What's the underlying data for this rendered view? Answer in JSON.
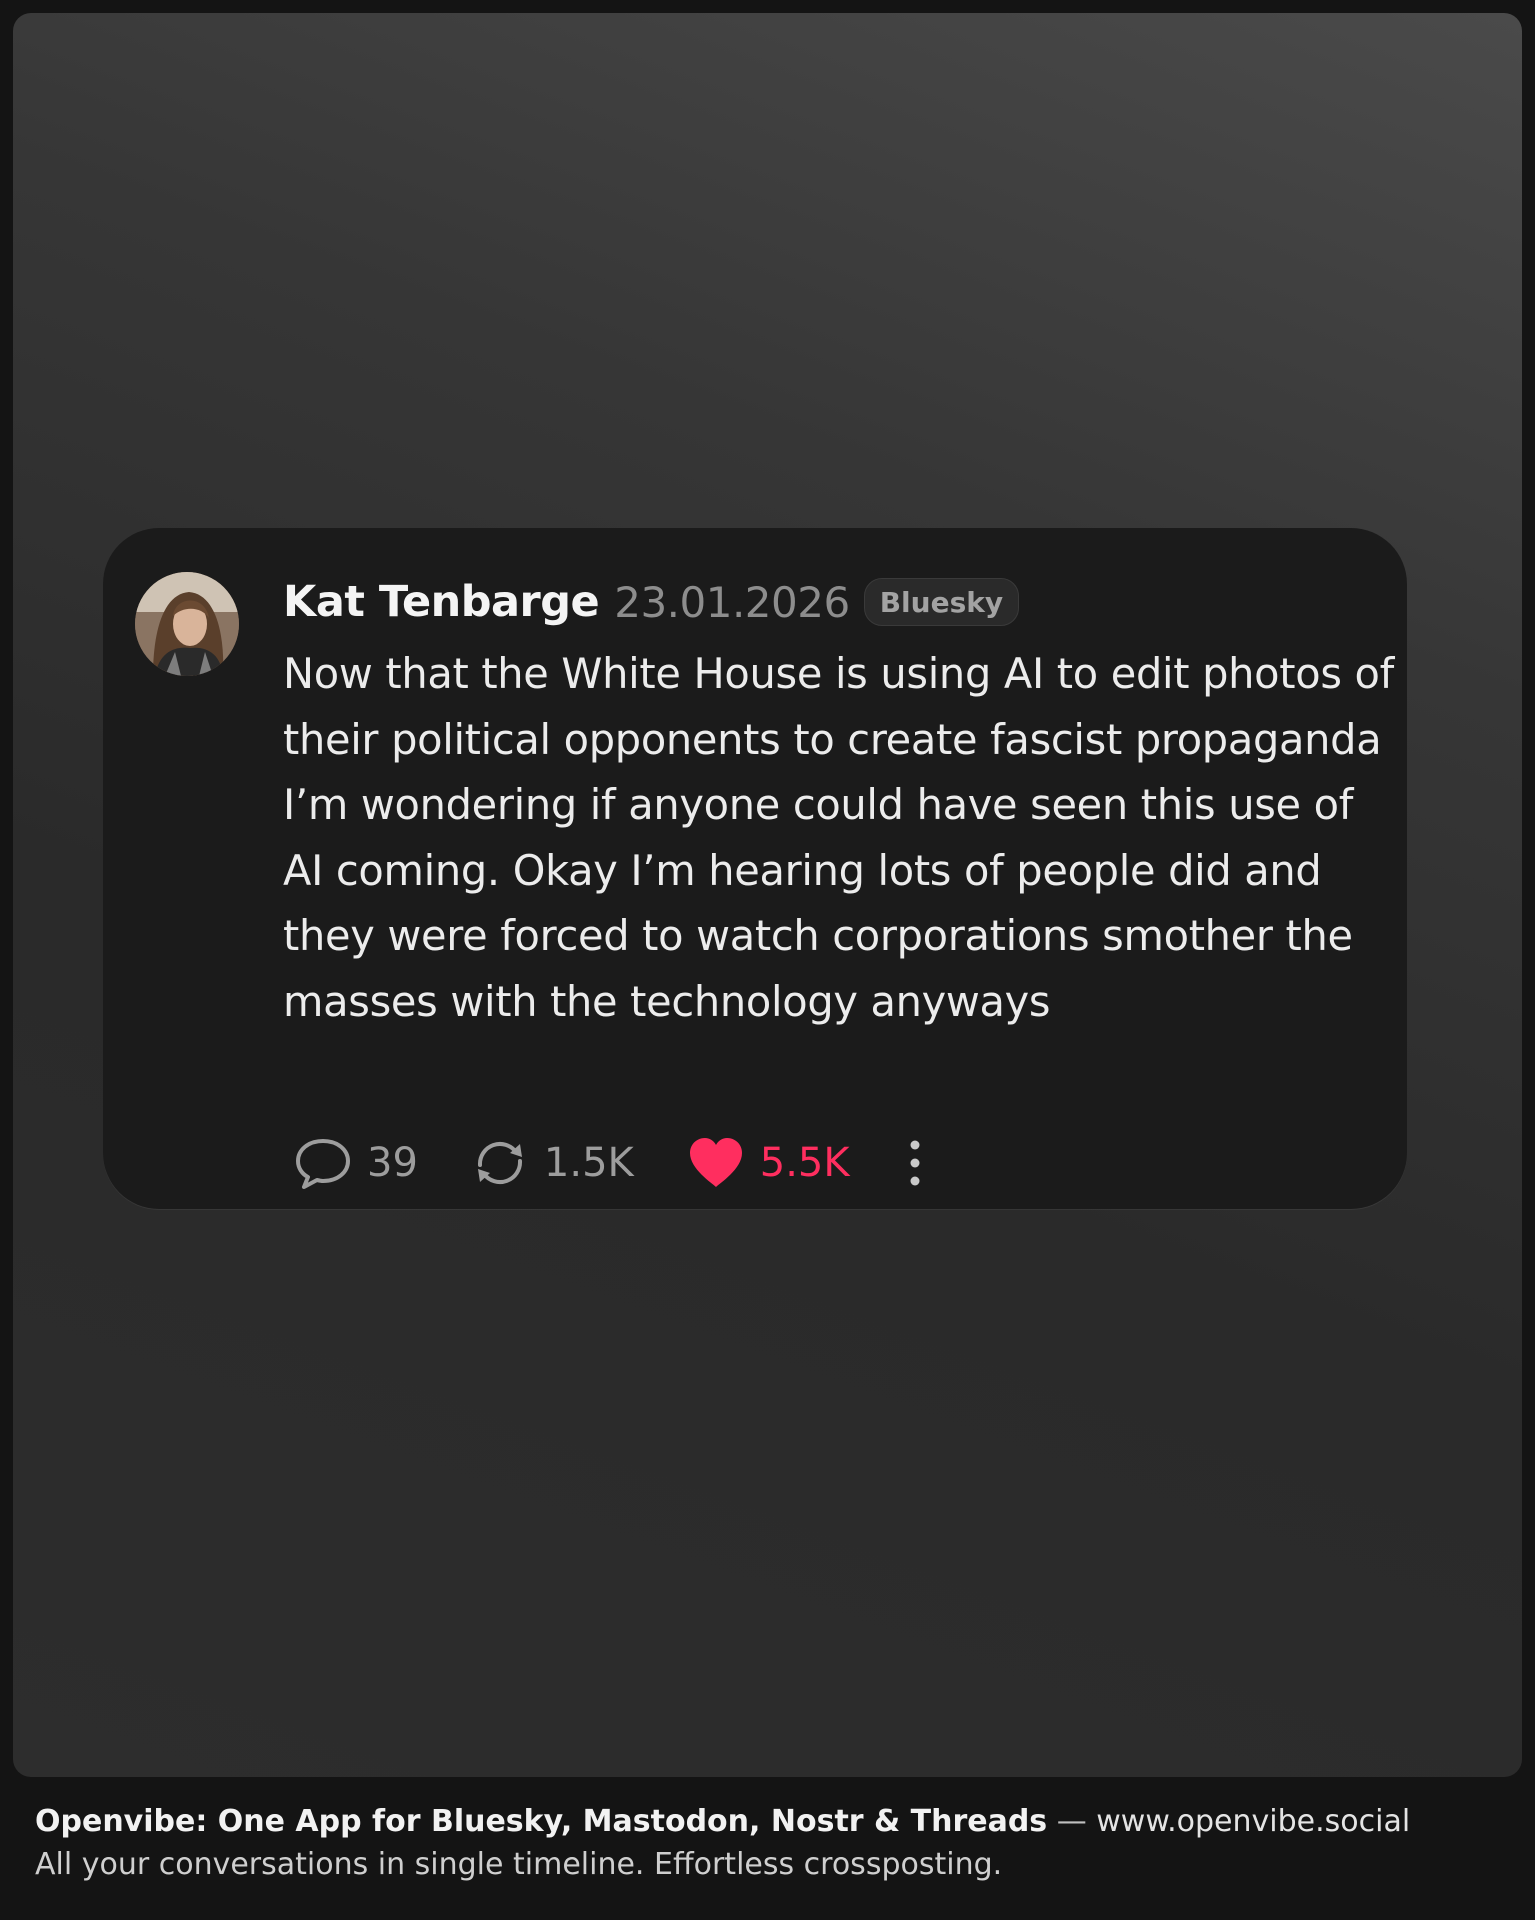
{
  "post": {
    "author": "Kat Tenbarge",
    "date": "23.01.2026",
    "platform_badge": "Bluesky",
    "text": "Now that the White House is using AI to edit photos of their political opponents to create fascist propaganda I’m wondering if anyone could have seen this use of AI coming. Okay I’m hearing lots of people did and they were forced to watch corporations smother the masses with the technology anyways",
    "replies": "39",
    "reposts": "1.5K",
    "likes": "5.5K",
    "icons": {
      "reply": "speech-bubble-icon",
      "repost": "repost-arrows-icon",
      "like": "heart-icon",
      "more": "vertical-dots-icon"
    }
  },
  "footer": {
    "headline": "Openvibe: One App for Bluesky, Mastodon, Nostr & Threads",
    "separator": "—",
    "url": "www.openvibe.social",
    "tagline": "All your conversations in single timeline. Effortless crossposting."
  },
  "colors": {
    "like_accent": "#ff2e5f",
    "card_bg": "#1b1b1b",
    "frame_top": "#4a4a4a"
  }
}
